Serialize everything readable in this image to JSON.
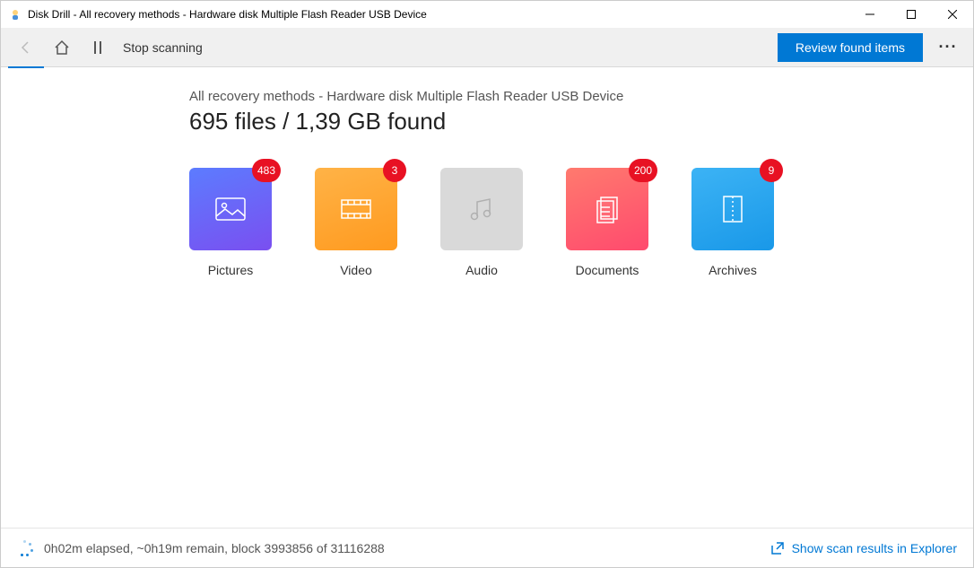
{
  "window": {
    "title": "Disk Drill - All recovery methods - Hardware disk Multiple Flash Reader USB Device"
  },
  "toolbar": {
    "stop_label": "Stop scanning",
    "review_label": "Review found items"
  },
  "main": {
    "subtitle": "All recovery methods - Hardware disk Multiple Flash Reader USB Device",
    "headline": "695 files / 1,39 GB found",
    "categories": [
      {
        "key": "pictures",
        "label": "Pictures",
        "badge": "483",
        "tile_class": "cat-pictures",
        "icon": "image"
      },
      {
        "key": "video",
        "label": "Video",
        "badge": "3",
        "tile_class": "cat-video",
        "icon": "film"
      },
      {
        "key": "audio",
        "label": "Audio",
        "badge": null,
        "tile_class": "cat-audio",
        "icon": "music"
      },
      {
        "key": "documents",
        "label": "Documents",
        "badge": "200",
        "tile_class": "cat-documents",
        "icon": "doc"
      },
      {
        "key": "archives",
        "label": "Archives",
        "badge": "9",
        "tile_class": "cat-archives",
        "icon": "zip"
      }
    ]
  },
  "status": {
    "text": "0h02m elapsed, ~0h19m remain, block 3993856 of 31116288",
    "explorer_link": "Show scan results in Explorer"
  }
}
